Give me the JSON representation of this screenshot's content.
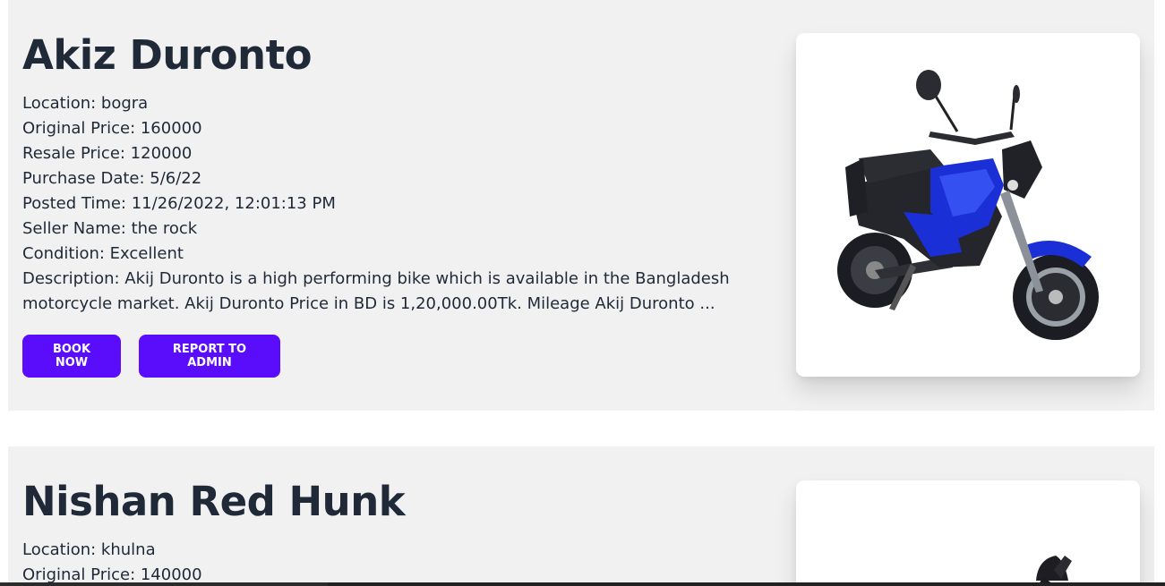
{
  "listings": [
    {
      "title": "Akiz Duronto",
      "location": "Location: bogra",
      "original_price": "Original Price: 160000",
      "resale_price": "Resale Price: 120000",
      "purchase_date": "Purchase Date: 5/6/22",
      "posted_time": "Posted Time: 11/26/2022, 12:01:13 PM",
      "seller_name": "Seller Name: the rock",
      "condition": "Condition: Excellent",
      "description": "Description: Akij Duronto is a high performing bike which is available in the Bangladesh motorcycle market. Akij Duronto Price in BD is 1,20,000.00Tk. Mileage Akij Duronto ...",
      "book_label": "Book Now",
      "report_label": "Report to Admin",
      "image_icon": "blue-electric-motorcycle",
      "bike_color": "#1a2fd6"
    },
    {
      "title": "Nishan Red Hunk",
      "location": "Location: khulna",
      "original_price": "Original Price: 140000",
      "image_icon": "motorcycle-mirror"
    }
  ],
  "colors": {
    "button": "#5a0dfb",
    "card_bg": "#f1f1f2",
    "text": "#1f2937"
  }
}
